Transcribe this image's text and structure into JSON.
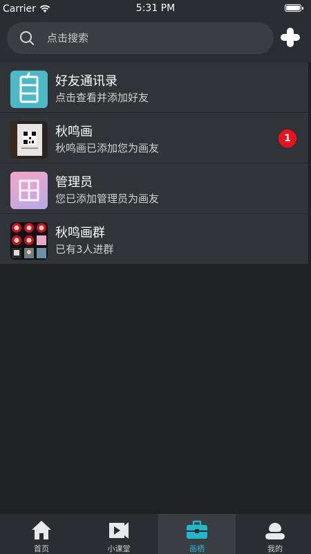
{
  "status": {
    "carrier": "Carrier",
    "time": "5:31 PM"
  },
  "search": {
    "placeholder": "点击搜索"
  },
  "items": [
    {
      "title": "好友通讯录",
      "subtitle": "点击查看并添加好友",
      "badge": ""
    },
    {
      "title": "秋鸣画",
      "subtitle": "秋鸣画已添加您为画友",
      "badge": "1"
    },
    {
      "title": "管理员",
      "subtitle": "您已添加管理员为画友",
      "badge": ""
    },
    {
      "title": "秋鸣画群",
      "subtitle": "已有3人进群",
      "badge": ""
    }
  ],
  "tabs": [
    {
      "label": "首页",
      "icon": "home-icon",
      "active": false
    },
    {
      "label": "小课堂",
      "icon": "video-icon",
      "active": false
    },
    {
      "label": "画栖",
      "icon": "briefcase-icon",
      "active": true
    },
    {
      "label": "我的",
      "icon": "user-icon",
      "active": false
    }
  ],
  "colors": {
    "accent": "#24b6c9",
    "badge": "#e8141f",
    "background": "#1f2124",
    "item": "#303337"
  }
}
